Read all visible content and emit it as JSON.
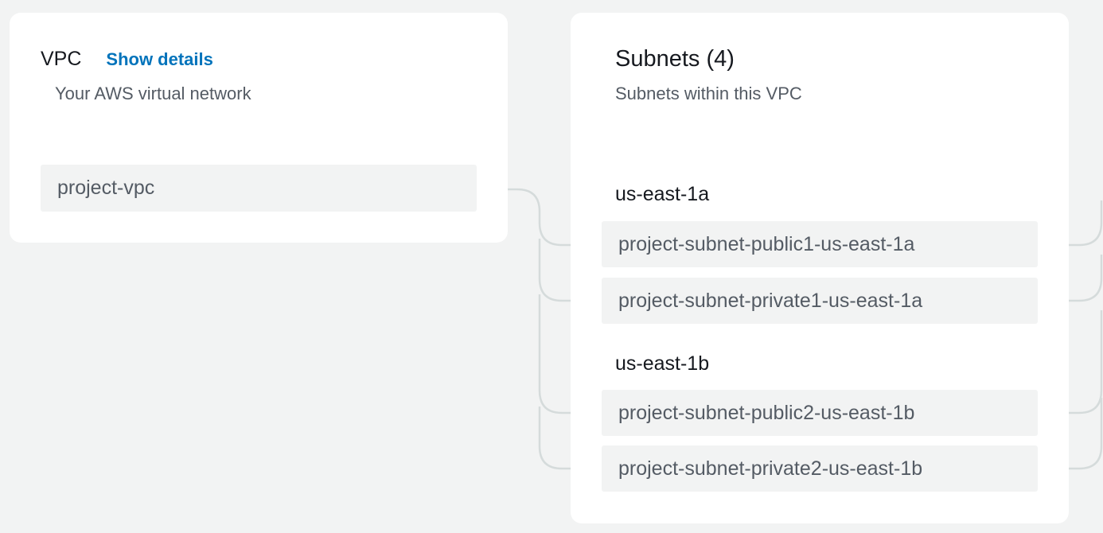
{
  "vpc": {
    "title": "VPC",
    "show_details": "Show details",
    "subtitle": "Your AWS virtual network",
    "name": "project-vpc"
  },
  "subnets": {
    "title": "Subnets (4)",
    "subtitle": "Subnets within this VPC",
    "zones": [
      {
        "name": "us-east-1a",
        "subnets": [
          "project-subnet-public1-us-east-1a",
          "project-subnet-private1-us-east-1a"
        ]
      },
      {
        "name": "us-east-1b",
        "subnets": [
          "project-subnet-public2-us-east-1b",
          "project-subnet-private2-us-east-1b"
        ]
      }
    ]
  },
  "colors": {
    "background": "#f2f3f3",
    "card": "#ffffff",
    "link": "#0073bb",
    "connector": "#d5dbdb"
  }
}
